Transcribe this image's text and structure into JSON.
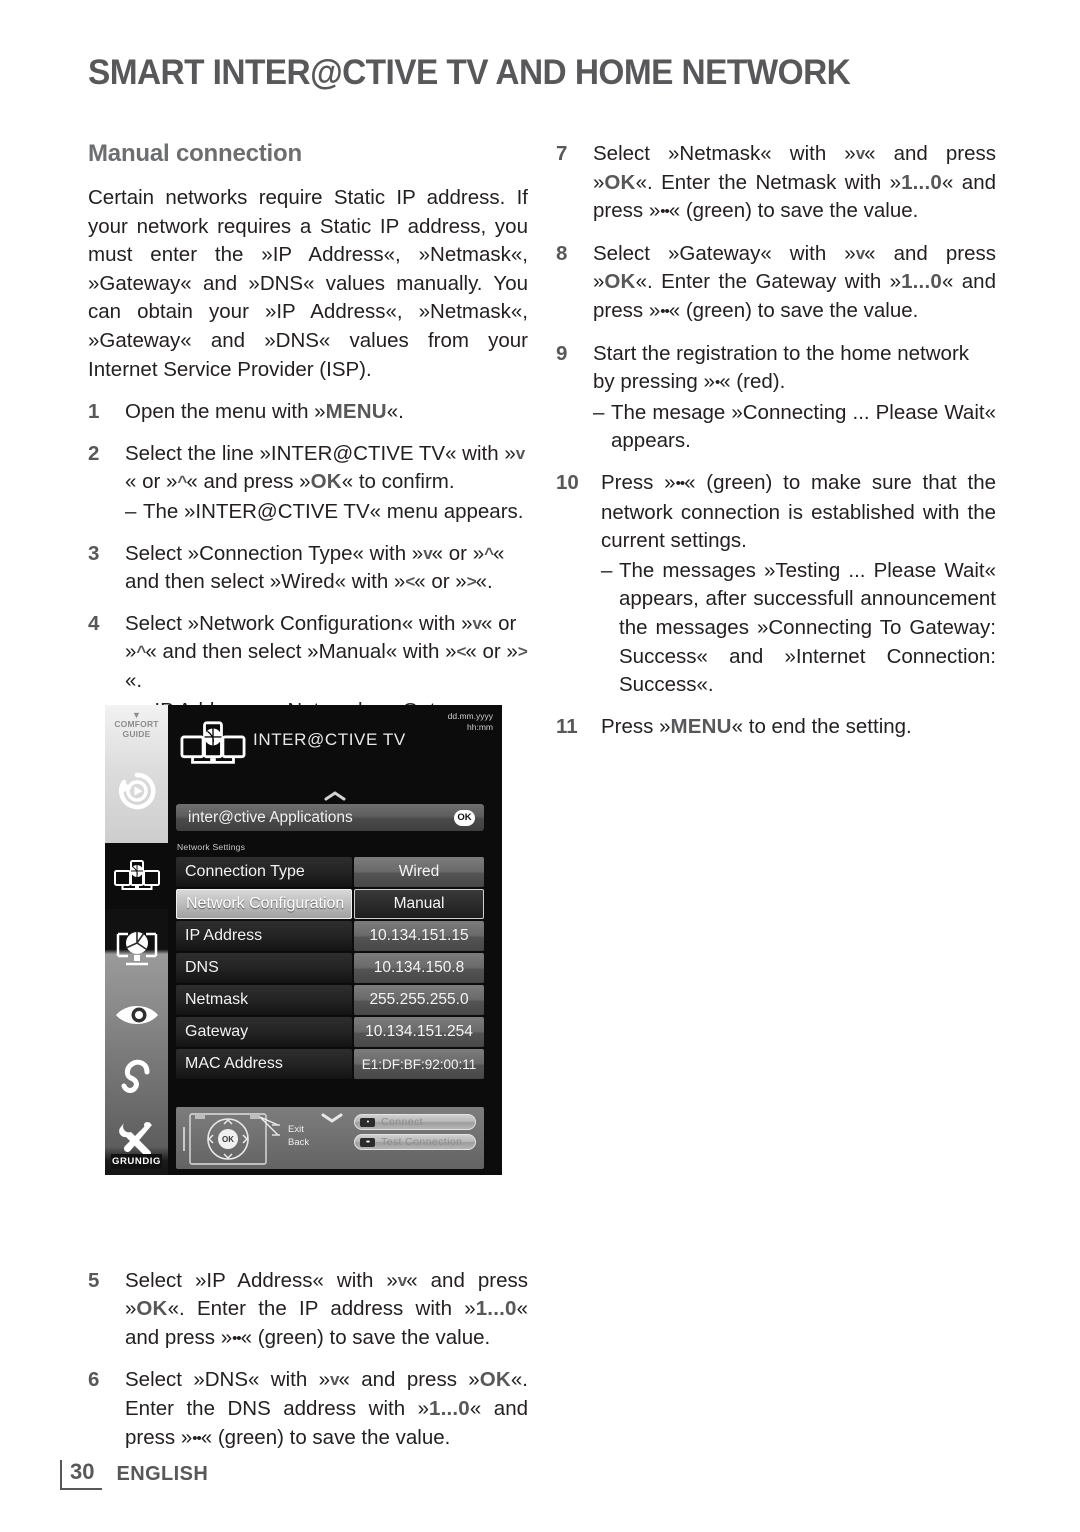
{
  "header": {
    "title": "SMART INTER@CTIVE TV AND HOME NETWORK"
  },
  "left": {
    "section_title": "Manual connection",
    "intro": "Certain networks require Static IP address. If your network requires a Static IP address, you must enter the »IP Address«, »Netmask«, »Gateway« and »DNS« values manually. You can obtain your »IP Address«, »Netmask«, »Gateway« and »DNS« values from your Internet Service Provider (ISP).",
    "steps": [
      {
        "num": "1",
        "pre": "Open the menu with »",
        "key": "MENU",
        "post": "«."
      },
      {
        "num": "2",
        "t1": "Select the line »INTER@CTIVE TV« with »",
        "a1": "v",
        "t2": "« or »",
        "a2": "^",
        "t3": "« and press »",
        "k1": "OK",
        "t4": "« to confirm.",
        "dash": "The »INTER@CTIVE TV« menu appears."
      },
      {
        "num": "3",
        "t1": "Select »Connection Type« with »",
        "a1": "v",
        "t2": "« or »",
        "a2": "^",
        "t3": "« and then select »Wired« with »",
        "a3": "<",
        "t4": "« or »",
        "a4": ">",
        "t5": "«."
      },
      {
        "num": "4",
        "t1": "Select »Network Configuration« with »",
        "a1": "v",
        "t2": "« or »",
        "a2": "^",
        "t3": "« and then select »Manual« with »",
        "a3": "<",
        "t4": "« or »",
        "a4": ">",
        "t5": "«.",
        "dash": "»IP Address«, »Netmask«, »Gateway« and »DNS« options are active."
      },
      {
        "num": "5",
        "t1": "Select »IP Address« with »",
        "a1": "v",
        "t2": "« and press »",
        "k1": "OK",
        "t3": "«. Enter the IP address with »",
        "k2": "1...0",
        "t4": "« and press »",
        "dots": "••",
        "t5": "« (green) to save the value."
      },
      {
        "num": "6",
        "t1": "Select »DNS« with »",
        "a1": "v",
        "t2": "« and press »",
        "k1": "OK",
        "t3": "«. Enter the DNS address with »",
        "k2": "1...0",
        "t4": "« and press »",
        "dots": "••",
        "t5": "« (green) to save the value."
      }
    ]
  },
  "right": {
    "steps": [
      {
        "num": "7",
        "t1": "Select »Netmask« with »",
        "a1": "v",
        "t2": "« and press »",
        "k1": "OK",
        "t3": "«. Enter the Netmask with »",
        "k2": "1...0",
        "t4": "« and press »",
        "dots": "••",
        "t5": "« (green) to save the value."
      },
      {
        "num": "8",
        "t1": "Select »Gateway« with »",
        "a1": "v",
        "t2": "« and press »",
        "k1": "OK",
        "t3": "«. Enter the Gateway with »",
        "k2": "1...0",
        "t4": "« and press »",
        "dots": "••",
        "t5": "« (green) to save the value."
      },
      {
        "num": "9",
        "t1": "Start the registration to the home network by pressing »",
        "dots": "•",
        "t2": "« (red).",
        "dash": "The mesage »Connecting ... Please Wait« appears."
      },
      {
        "num": "10",
        "t1": "Press »",
        "dots": "••",
        "t2": "« (green) to make sure that the network connection is established with the current settings.",
        "dash": "The messages »Testing ... Please Wait« appears, after successfull announcement the messages »Connecting To Gateway: Success« and »Internet Connection: Success«."
      },
      {
        "num": "11",
        "pre": "Press »",
        "key": "MENU",
        "post": "« to end the setting."
      }
    ]
  },
  "tv_figure": {
    "rail": {
      "comfort_caret": "▼",
      "comfort_line1": "COMFORT",
      "comfort_line2": "GUIDE",
      "brand": "GRUNDIG",
      "icons": [
        "media-play-icon",
        "interactive-tv-icon",
        "picture-settings-icon",
        "eye-icon",
        "ear-icon",
        "tools-icon"
      ]
    },
    "clock": {
      "date": "dd.mm.yyyy",
      "time": "hh:mm"
    },
    "menu_title": "INTER@CTIVE TV",
    "up_caret": "⌃",
    "down_caret": "⌄",
    "apps_row": {
      "label": "inter@ctive Applications",
      "badge": "OK"
    },
    "network_label": "Network Settings",
    "rows": [
      {
        "name": "Connection Type",
        "value": "Wired",
        "selected": false
      },
      {
        "name": "Network Configuration",
        "value": "Manual",
        "selected": true
      },
      {
        "name": "IP Address",
        "value": "10.134.151.15",
        "selected": false
      },
      {
        "name": "DNS",
        "value": "10.134.150.8",
        "selected": false
      },
      {
        "name": "Netmask",
        "value": "255.255.255.0",
        "selected": false
      },
      {
        "name": "Gateway",
        "value": "10.134.151.254",
        "selected": false
      },
      {
        "name": "MAC Address",
        "value": "E1:DF:BF:92:00:11",
        "selected": false
      }
    ],
    "footer": {
      "exit": "Exit",
      "back": "Back",
      "ok": "OK",
      "connect_button": "Connect",
      "test_button": "Test Connection"
    }
  },
  "footer": {
    "page_number": "30",
    "language": "ENGLISH"
  },
  "colors": {
    "heading_gray": "#58585a",
    "subheading_gray": "#6d6e70",
    "body_black": "#231f20"
  }
}
